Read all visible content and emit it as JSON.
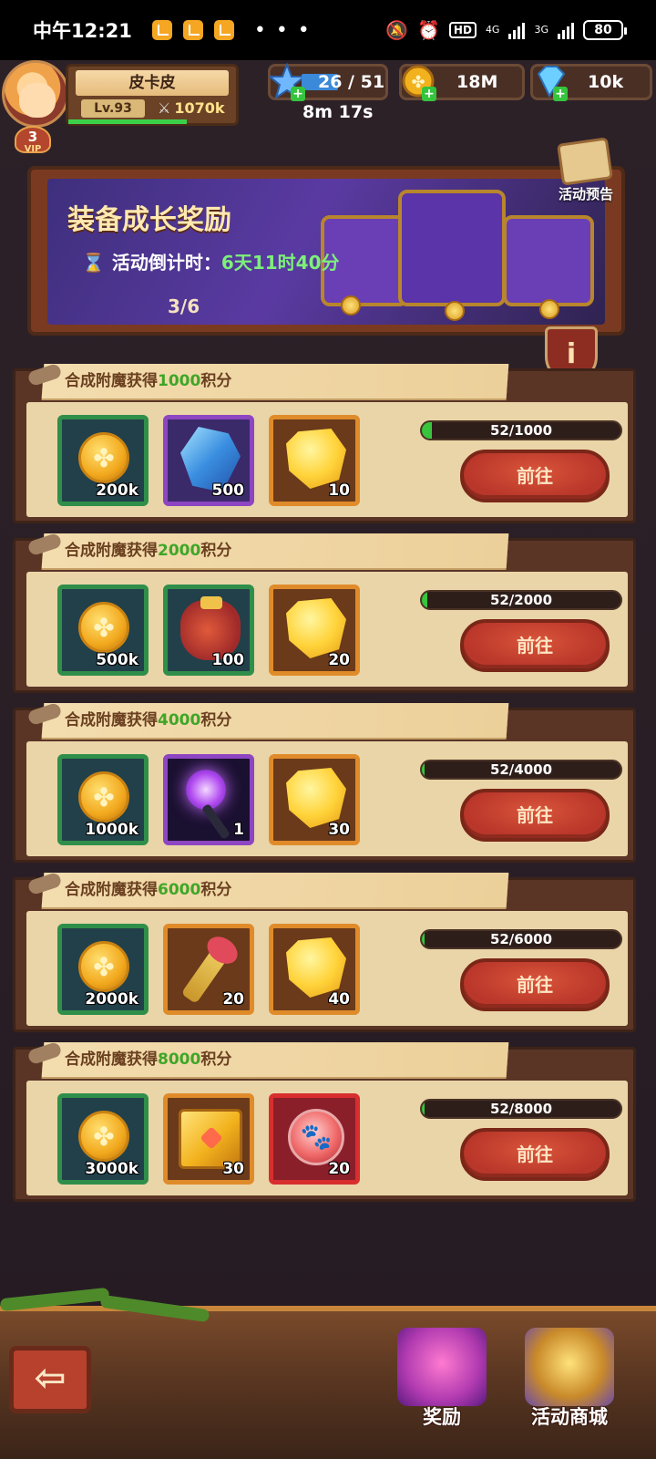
{
  "status_bar": {
    "time": "中午12:21",
    "more": "• • •",
    "hd": "HD",
    "net1": "4G",
    "net2": "3G",
    "battery": "80"
  },
  "player": {
    "name": "皮卡皮",
    "level": "Lv.93",
    "power": "1070k",
    "vip_level": "3",
    "vip_label": "VIP"
  },
  "resources": {
    "stars": "26 / 51",
    "energy_timer": "8m 17s",
    "coins": "18M",
    "gems": "10k"
  },
  "banner": {
    "title": "装备成长奖励",
    "countdown_label": "活动倒计时：",
    "countdown_value": "6天11时40分",
    "page": "3/6",
    "preview_label": "活动预告",
    "info": "i"
  },
  "tasks": [
    {
      "title_prefix": "合成附魔获得",
      "title_num": "1000",
      "title_suffix": "积分",
      "rewards": [
        {
          "icon": "coin-icon",
          "qty": "200k",
          "rarity": "green"
        },
        {
          "icon": "blue-crystal-icon",
          "qty": "500",
          "rarity": "purple"
        },
        {
          "icon": "gold-ore-icon",
          "qty": "10",
          "rarity": "orange"
        }
      ],
      "progress_text": "52/1000",
      "progress": 0.052,
      "button": "前往"
    },
    {
      "title_prefix": "合成附魔获得",
      "title_num": "2000",
      "title_suffix": "积分",
      "rewards": [
        {
          "icon": "coin-icon",
          "qty": "500k",
          "rarity": "green"
        },
        {
          "icon": "loot-bag-icon",
          "qty": "100",
          "rarity": "green"
        },
        {
          "icon": "gold-ore-icon",
          "qty": "20",
          "rarity": "orange"
        }
      ],
      "progress_text": "52/2000",
      "progress": 0.026,
      "button": "前往"
    },
    {
      "title_prefix": "合成附魔获得",
      "title_num": "4000",
      "title_suffix": "积分",
      "rewards": [
        {
          "icon": "coin-icon",
          "qty": "1000k",
          "rarity": "green"
        },
        {
          "icon": "lightning-staff-icon",
          "qty": "1",
          "rarity": "purple"
        },
        {
          "icon": "gold-ore-icon",
          "qty": "30",
          "rarity": "orange"
        }
      ],
      "progress_text": "52/4000",
      "progress": 0.013,
      "button": "前往"
    },
    {
      "title_prefix": "合成附魔获得",
      "title_num": "6000",
      "title_suffix": "积分",
      "rewards": [
        {
          "icon": "coin-icon",
          "qty": "2000k",
          "rarity": "green"
        },
        {
          "icon": "magic-wand-icon",
          "qty": "20",
          "rarity": "orange"
        },
        {
          "icon": "gold-ore-icon",
          "qty": "40",
          "rarity": "orange"
        }
      ],
      "progress_text": "52/6000",
      "progress": 0.0087,
      "button": "前往"
    },
    {
      "title_prefix": "合成附魔获得",
      "title_num": "8000",
      "title_suffix": "积分",
      "rewards": [
        {
          "icon": "coin-icon",
          "qty": "3000k",
          "rarity": "green"
        },
        {
          "icon": "gold-box-icon",
          "qty": "30",
          "rarity": "orange"
        },
        {
          "icon": "paw-orb-icon",
          "qty": "20",
          "rarity": "red"
        }
      ],
      "progress_text": "52/8000",
      "progress": 0.0065,
      "button": "前往"
    }
  ],
  "bottom_nav": {
    "back_glyph": "⇦",
    "rewards_label": "奖励",
    "shop_label": "活动商城"
  },
  "colors": {
    "accent_green": "#3fa628",
    "button_red": "#b9362a",
    "parchment": "#ead5a8"
  }
}
